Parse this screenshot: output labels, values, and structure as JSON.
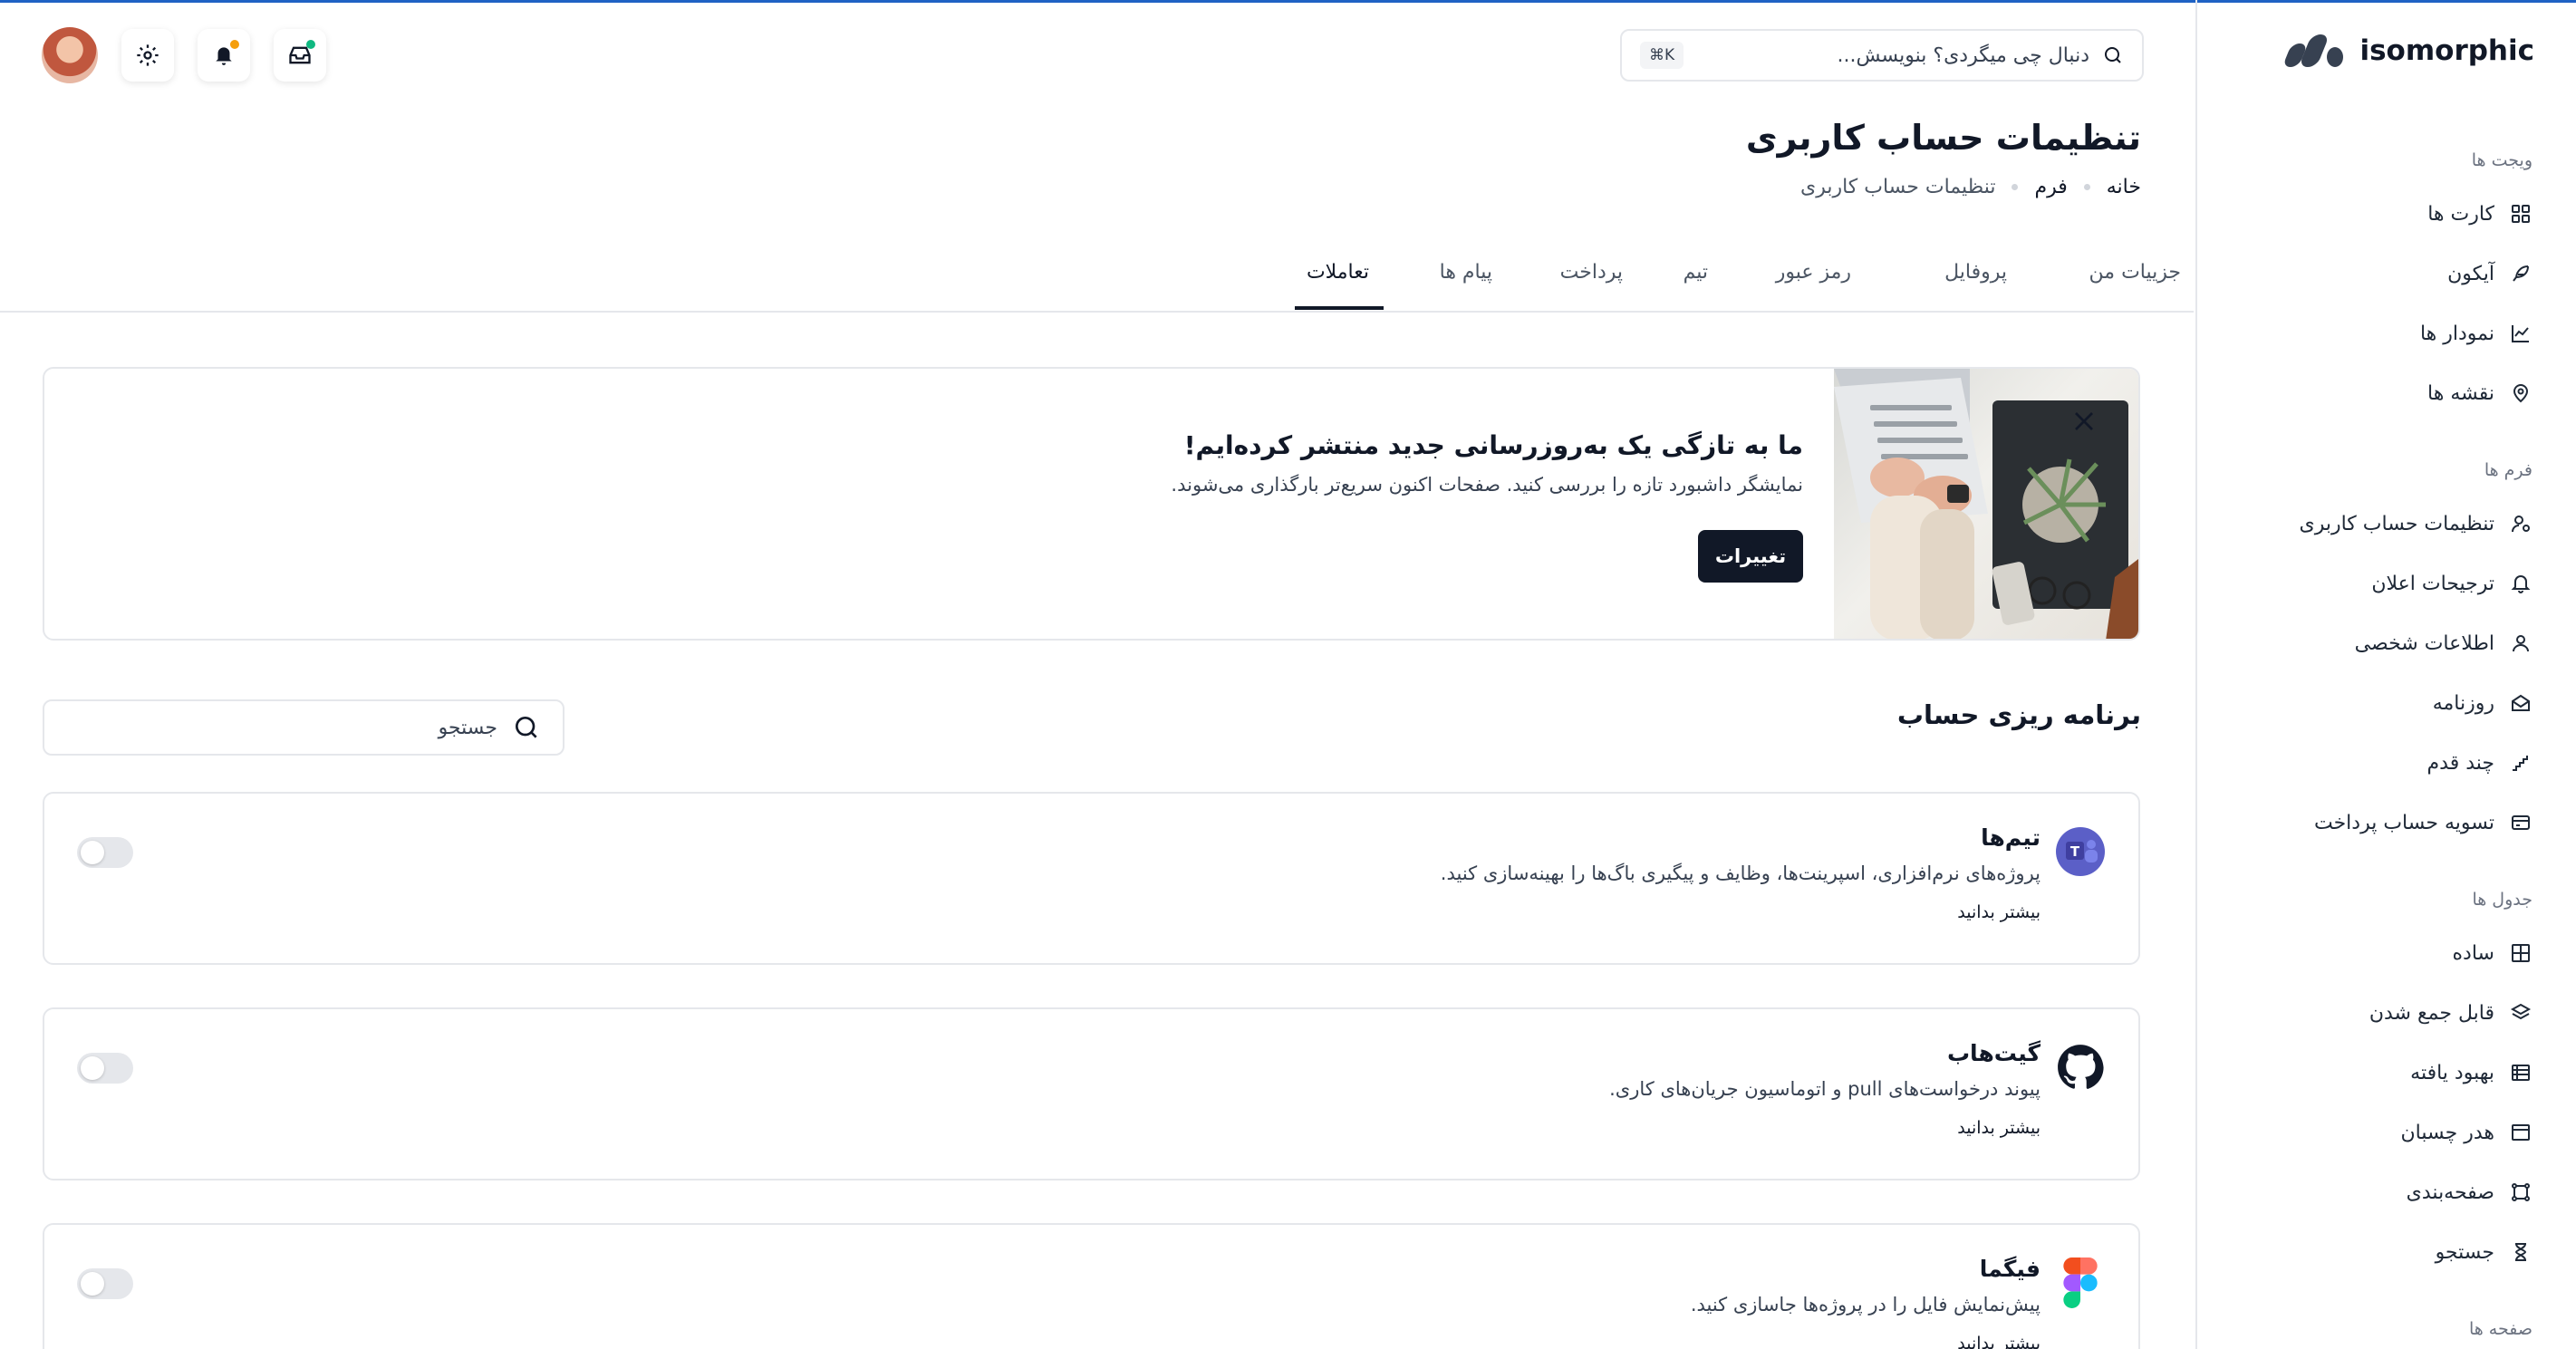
{
  "brand": {
    "name": "isomorphic"
  },
  "header": {
    "search_placeholder": "دنبال چی میگردی؟ بنویسش...",
    "shortcut": "⌘K",
    "colors": {
      "accent": "#1f62c4",
      "online": "#10b981",
      "notify": "#f59e0b"
    }
  },
  "sidebar": {
    "sections": [
      {
        "title": "ویجت ها",
        "items": [
          {
            "label": "کارت ها",
            "icon": "grid-icon"
          },
          {
            "label": "آیکون",
            "icon": "feather-icon"
          },
          {
            "label": "نمودار ها",
            "icon": "chart-line-icon"
          },
          {
            "label": "نقشه ها",
            "icon": "map-pin-icon"
          }
        ]
      },
      {
        "title": "فرم ها",
        "items": [
          {
            "label": "تنظیمات حساب کاربری",
            "icon": "user-settings-icon"
          },
          {
            "label": "ترجیحات اعلان",
            "icon": "bell-icon"
          },
          {
            "label": "اطلاعات شخصی",
            "icon": "user-icon"
          },
          {
            "label": "روزنامه",
            "icon": "mail-open-icon"
          },
          {
            "label": "چند قدم",
            "icon": "steps-icon"
          },
          {
            "label": "تسویه حساب پرداخت",
            "icon": "credit-card-icon"
          }
        ]
      },
      {
        "title": "جدول ها",
        "items": [
          {
            "label": "ساده",
            "icon": "table-icon"
          },
          {
            "label": "قابل جمع شدن",
            "icon": "layers-icon"
          },
          {
            "label": "بهبود یافته",
            "icon": "table-list-icon"
          },
          {
            "label": "هدر چسبان",
            "icon": "sticky-header-icon"
          },
          {
            "label": "صفحه‌بندی",
            "icon": "pagination-icon"
          },
          {
            "label": "جستجو",
            "icon": "hourglass-icon"
          }
        ]
      },
      {
        "title": "صفحه ها",
        "items": []
      }
    ]
  },
  "page": {
    "title": "تنظیمات حساب کاربری",
    "breadcrumb": [
      "خانه",
      "فرم",
      "تنظیمات حساب کاربری"
    ]
  },
  "tabs": [
    "جزییات من",
    "پروفایل",
    "رمز عبور",
    "تیم",
    "پرداخت",
    "پیام ها",
    "تعاملات"
  ],
  "active_tab": "تعاملات",
  "banner": {
    "title": "ما به تازگی یک به‌روزرسانی جدید منتشر کرده‌ایم!",
    "description": "نمایشگر داشبورد تازه را بررسی کنید. صفحات اکنون سریع‌تر بارگذاری می‌شوند.",
    "button": "تغییرات"
  },
  "section": {
    "title": "برنامه ریزی حساب",
    "search_placeholder": "جستجو"
  },
  "integrations": [
    {
      "name": "تیم‌ها",
      "description": "پروژه‌های نرم‌افزاری، اسپرینت‌ها، وظایف و پیگیری باگ‌ها را بهینه‌سازی کنید.",
      "link": "بیشتر بدانید",
      "enabled": false,
      "icon": "teams-icon"
    },
    {
      "name": "گیت‌هاب",
      "description": "پیوند درخواست‌های pull و اتوماسیون جریان‌های کاری.",
      "link": "بیشتر بدانید",
      "enabled": false,
      "icon": "github-icon"
    },
    {
      "name": "فیگما",
      "description": "پیش‌نمایش فایل را در پروژه‌ها جاسازی کنید.",
      "link": "بیشتر بدانید",
      "enabled": false,
      "icon": "figma-icon"
    }
  ]
}
